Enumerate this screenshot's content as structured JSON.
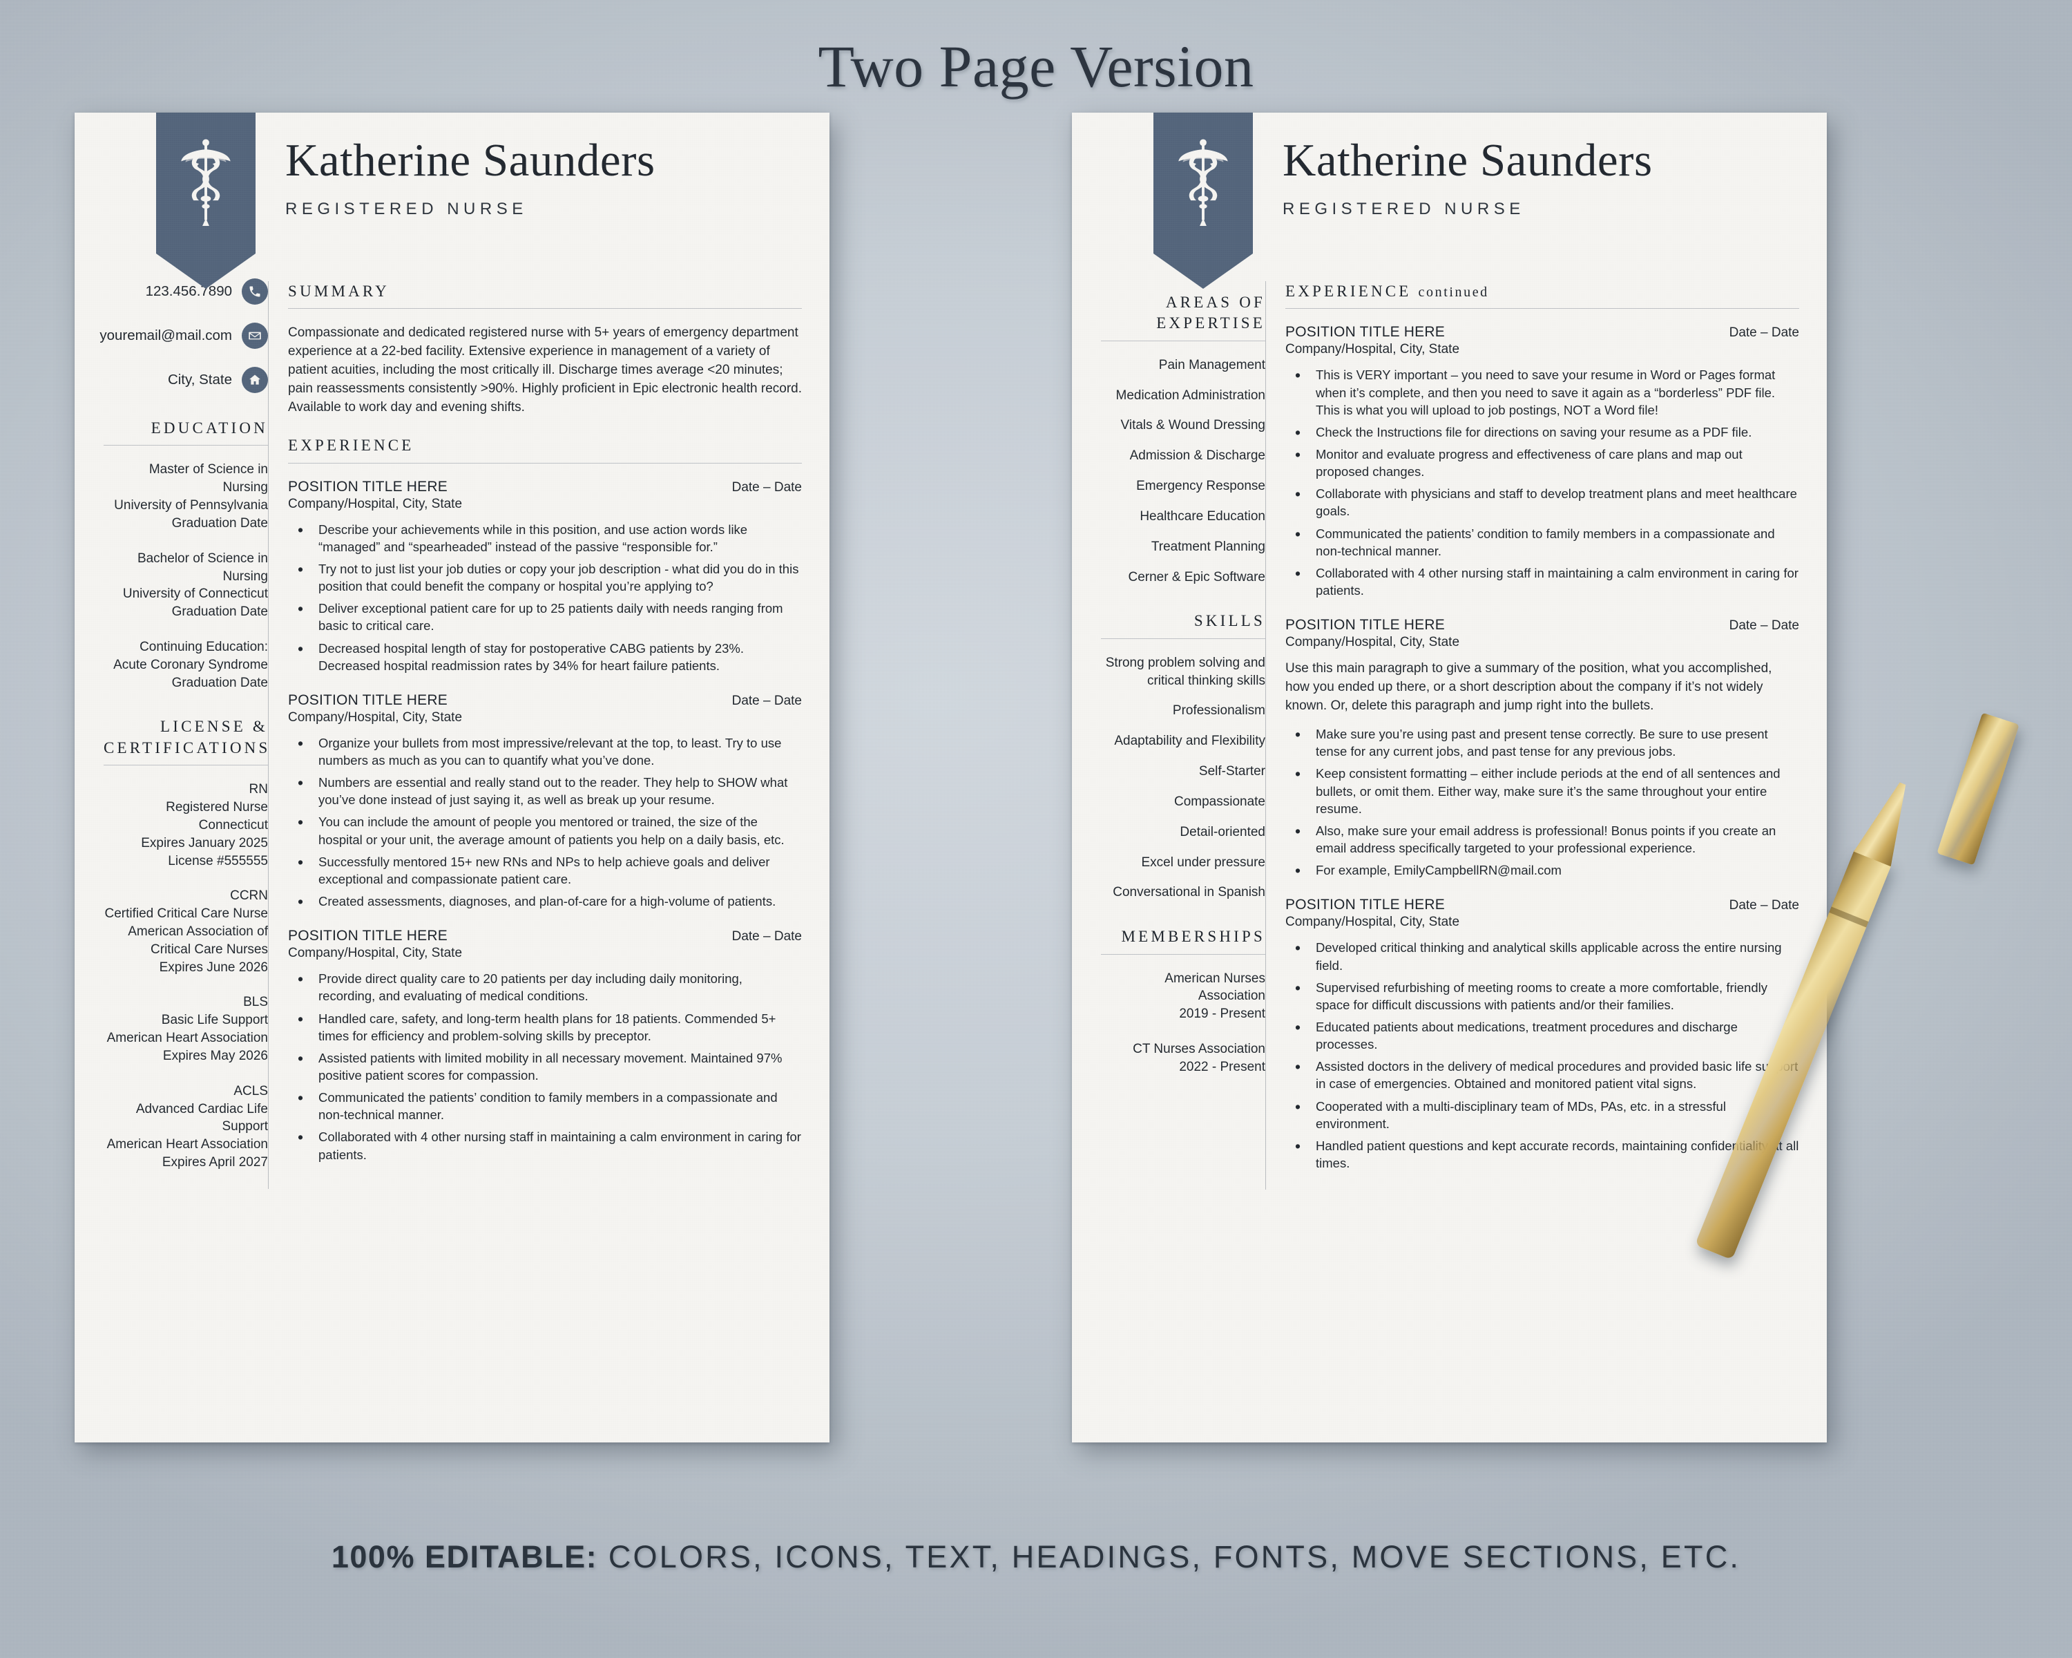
{
  "heading": "Two Page Version",
  "footer_caption": {
    "strong": "100% EDITABLE:",
    "rest": " COLORS, ICONS, TEXT, HEADINGS, FONTS, MOVE SECTIONS, ETC."
  },
  "colors": {
    "accent": "#52637a",
    "paper": "#f5f4f1",
    "backdrop": "#c3cad2",
    "ink": "#1f252c"
  },
  "resume": {
    "name": "Katherine Saunders",
    "role": "REGISTERED NURSE",
    "logo_icon": "caduceus-icon",
    "contact": [
      {
        "icon": "phone-icon",
        "value": "123.456.7890"
      },
      {
        "icon": "email-icon",
        "value": "youremail@mail.com"
      },
      {
        "icon": "home-icon",
        "value": "City, State"
      }
    ]
  },
  "page1": {
    "sidebar": {
      "education": {
        "heading": "EDUCATION",
        "entries": [
          [
            "Master of Science in Nursing",
            "University of Pennsylvania",
            "Graduation Date"
          ],
          [
            "Bachelor of Science in Nursing",
            "University of Connecticut",
            "Graduation Date"
          ],
          [
            "Continuing Education:",
            "Acute Coronary Syndrome",
            "Graduation Date"
          ]
        ]
      },
      "license": {
        "heading": "LICENSE & CERTIFICATIONS",
        "entries": [
          [
            "RN",
            "Registered Nurse",
            "Connecticut",
            "Expires January 2025",
            "License #555555"
          ],
          [
            "CCRN",
            "Certified Critical Care Nurse",
            "American Association of",
            "Critical Care Nurses",
            "Expires June 2026"
          ],
          [
            "BLS",
            "Basic Life Support",
            "American Heart Association",
            "Expires May 2026"
          ],
          [
            "ACLS",
            "Advanced Cardiac Life Support",
            "American Heart Association",
            "Expires April 2027"
          ]
        ]
      }
    },
    "main": {
      "summary_heading": "SUMMARY",
      "summary_text": "Compassionate and dedicated registered nurse with 5+ years of emergency department experience at a 22-bed facility. Extensive experience in management of a variety of patient acuities, including the most critically ill. Discharge times average <20 minutes; pain reassessments consistently >90%. Highly proficient in Epic electronic health record. Available to work day and evening shifts.",
      "experience_heading": "EXPERIENCE",
      "jobs": [
        {
          "title": "POSITION TITLE HERE",
          "date": "Date – Date",
          "org": "Company/Hospital, City, State",
          "bullets": [
            "Describe your achievements while in this position, and use action words like “managed” and “spearheaded” instead of the passive “responsible for.”",
            "Try not to just list your job duties or copy your job description - what did you do in this position that could benefit the company or hospital you’re applying to?",
            "Deliver exceptional patient care for up to 25 patients daily with needs ranging from basic to critical care.",
            "Decreased hospital length of stay for postoperative CABG patients by 23%. Decreased hospital readmission rates by 34% for heart failure patients."
          ]
        },
        {
          "title": "POSITION TITLE HERE",
          "date": "Date – Date",
          "org": "Company/Hospital, City, State",
          "bullets": [
            "Organize your bullets from most impressive/relevant at the top, to least. Try to use numbers as much as you can to quantify what you’ve done.",
            "Numbers are essential and really stand out to the reader.  They help to SHOW what you’ve done instead of just saying it, as well as break up your resume.",
            "You can include the amount of people you mentored or trained, the size of the hospital or your unit, the average amount of patients you help on a daily basis, etc.",
            "Successfully mentored 15+ new RNs and NPs to help achieve goals and deliver exceptional and compassionate patient care.",
            "Created assessments, diagnoses, and plan-of-care for a high-volume of patients."
          ]
        },
        {
          "title": "POSITION TITLE HERE",
          "date": "Date – Date",
          "org": "Company/Hospital, City, State",
          "bullets": [
            "Provide direct quality care to 20 patients per day including daily monitoring, recording, and evaluating of medical conditions.",
            "Handled care, safety, and long-term health plans for 18 patients. Commended 5+ times for efficiency and problem-solving skills by preceptor.",
            "Assisted patients with limited mobility in all necessary movement. Maintained 97% positive patient scores for compassion.",
            "Communicated the patients’ condition to family members in a compassionate and non-technical manner.",
            "Collaborated with 4 other nursing staff in maintaining a calm environment in caring for patients."
          ]
        }
      ]
    }
  },
  "page2": {
    "sidebar": {
      "expertise_heading": "AREAS OF EXPERTISE",
      "expertise": [
        "Pain Management",
        "Medication Administration",
        "Vitals & Wound Dressing",
        "Admission & Discharge",
        "Emergency Response",
        "Healthcare Education",
        "Treatment Planning",
        "Cerner & Epic Software"
      ],
      "skills_heading": "SKILLS",
      "skills": [
        "Strong problem solving and critical thinking skills",
        "Professionalism",
        "Adaptability and Flexibility",
        "Self-Starter",
        "Compassionate",
        "Detail-oriented",
        "Excel under pressure",
        "Conversational in Spanish"
      ],
      "memberships_heading": "MEMBERSHIPS",
      "memberships": [
        [
          "American Nurses Association",
          "2019 - Present"
        ],
        [
          "CT Nurses Association",
          "2022 - Present"
        ]
      ]
    },
    "main": {
      "experience_heading": "EXPERIENCE",
      "experience_heading_light": "continued",
      "jobs": [
        {
          "title": "POSITION TITLE HERE",
          "date": "Date – Date",
          "org": "Company/Hospital, City, State",
          "bullets": [
            "This is VERY important – you need to save your resume in Word or Pages format when it’s complete, and then you need to save it again as a “borderless” PDF file. This is what you will upload to job postings, NOT a Word file!",
            "Check the Instructions file for directions on saving your resume as a PDF file.",
            "Monitor and evaluate progress and effectiveness of care plans and map out proposed changes.",
            "Collaborate with physicians and staff to develop treatment plans and meet healthcare goals.",
            "Communicated the patients’ condition to family members in a compassionate and non-technical manner.",
            "Collaborated with 4 other nursing staff in maintaining a calm environment in caring for patients."
          ]
        },
        {
          "title": "POSITION TITLE HERE",
          "date": "Date – Date",
          "org": "Company/Hospital, City, State",
          "intro": "Use this main paragraph to give a summary of the position, what you accomplished, how you ended up there, or a short description about the company if it’s not widely known. Or, delete this paragraph and jump right into the bullets.",
          "bullets": [
            "Make sure you’re using past and present tense correctly. Be sure to use present tense for any current jobs, and past tense for any previous jobs.",
            "Keep consistent formatting – either include periods at the end of all sentences and bullets, or omit them.  Either way, make sure it’s the same throughout your entire resume.",
            "Also, make sure your email address is professional!  Bonus points if you create an email address specifically targeted to your professional experience.",
            "For example, EmilyCampbellRN@mail.com"
          ]
        },
        {
          "title": "POSITION TITLE HERE",
          "date": "Date – Date",
          "org": "Company/Hospital, City, State",
          "bullets": [
            "Developed critical thinking and analytical skills applicable across the entire nursing field.",
            "Supervised refurbishing of meeting rooms to create a more comfortable, friendly space for difficult discussions with patients and/or their families.",
            "Educated patients about medications, treatment procedures and discharge processes.",
            "Assisted doctors in the delivery of medical procedures and provided basic life support in case of emergencies. Obtained and monitored patient vital signs.",
            "Cooperated with a multi-disciplinary team of MDs, PAs, etc. in a stressful environment.",
            "Handled patient questions and kept accurate records, maintaining confidentiality at all times."
          ]
        }
      ]
    }
  }
}
